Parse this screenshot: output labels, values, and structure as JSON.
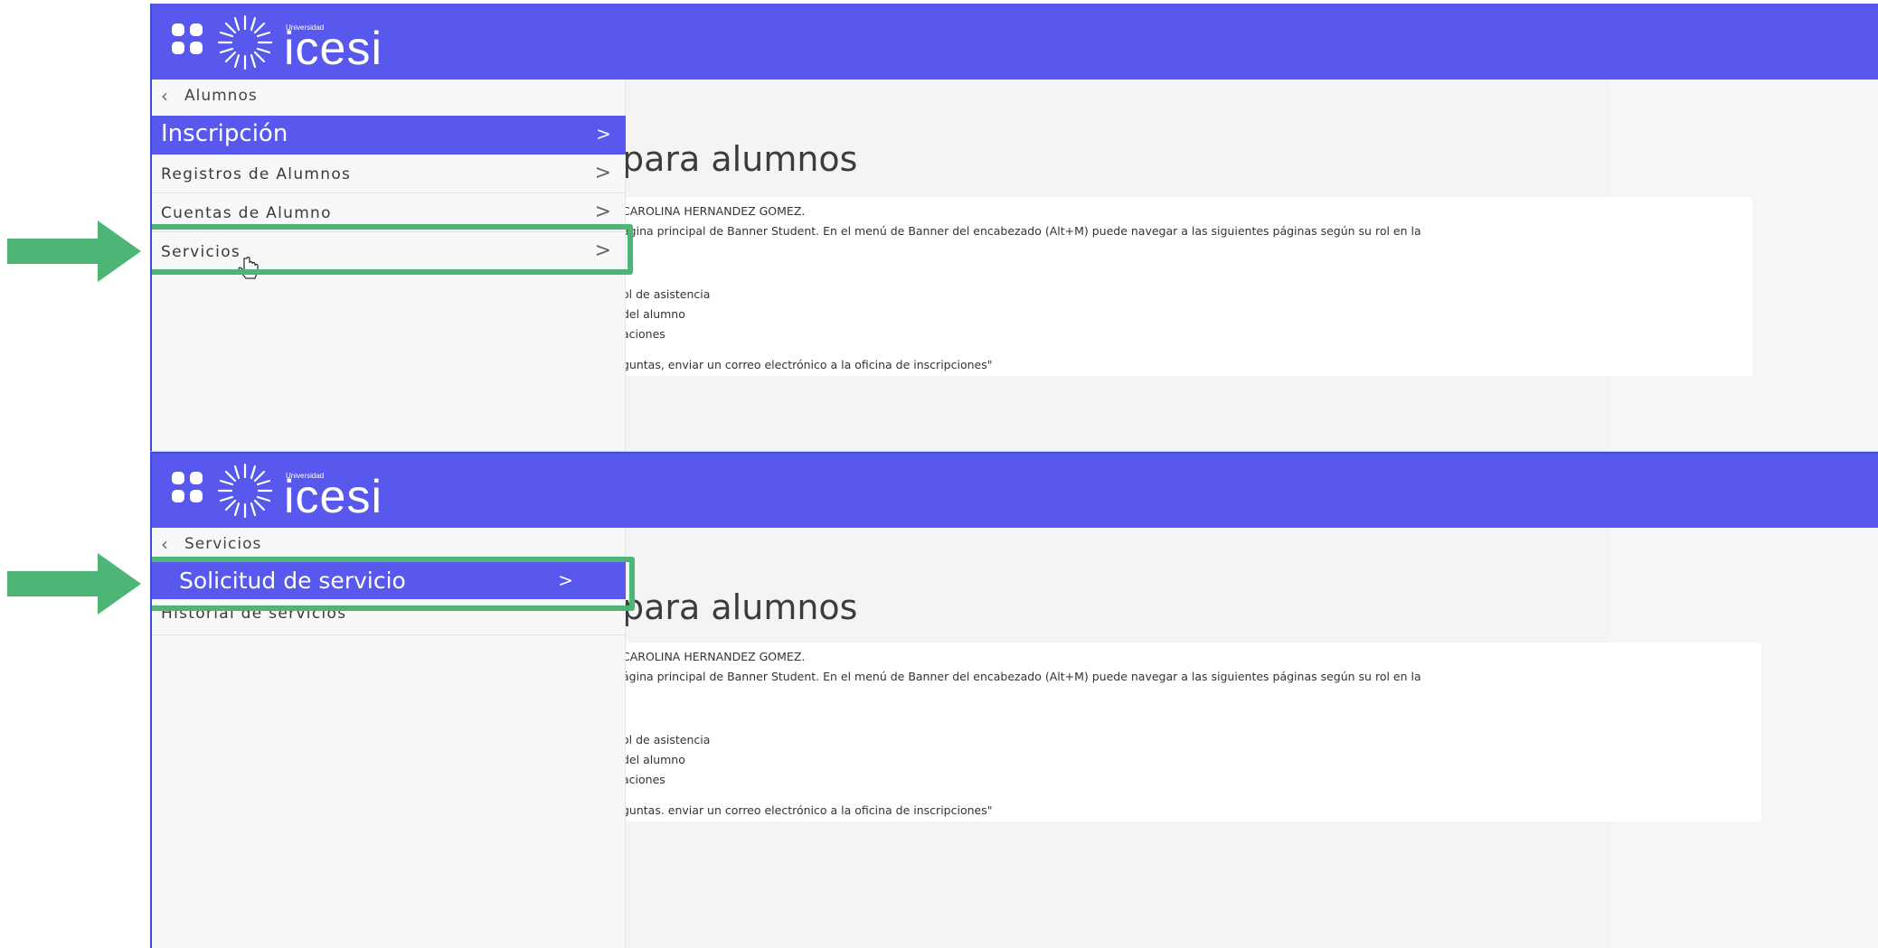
{
  "colors": {
    "header_bg": "#5858ee",
    "active_item_bg": "#5858ee",
    "highlight": "#4db575",
    "arrow": "#4db575"
  },
  "logo": {
    "small_text": "Universidad",
    "word": "icesi"
  },
  "panel1": {
    "back_label": "Alumnos",
    "menu": [
      {
        "label": "Inscripción",
        "arrow": ">",
        "active": true
      },
      {
        "label": "Registros de Alumnos",
        "arrow": ">",
        "active": false
      },
      {
        "label": "Cuentas de Alumno",
        "arrow": ">",
        "active": false
      },
      {
        "label": "Servicios",
        "arrow": ">",
        "active": false,
        "highlighted": true
      }
    ],
    "heading": "para alumnos",
    "card": {
      "greeting": "CAROLINA HERNANDEZ GOMEZ.",
      "intro": "ágina principal de Banner Student. En el menú de Banner del encabezado (Alt+M) puede navegar a las siguientes páginas según su rol en la",
      "items": [
        "ol de asistencia",
        "del alumno",
        "aciones"
      ],
      "contact": "guntas, enviar un correo electrónico a la oficina de inscripciones\""
    }
  },
  "panel2": {
    "back_label": "Servicios",
    "menu": [
      {
        "label": "Solicitud de servicio",
        "arrow": ">",
        "active": true,
        "highlighted": true
      },
      {
        "label": "Historial de servicios",
        "arrow": "",
        "active": false
      }
    ],
    "heading": "para alumnos",
    "card": {
      "greeting": "CAROLINA HERNANDEZ GOMEZ.",
      "intro": "ágina principal de Banner Student. En el menú de Banner del encabezado (Alt+M) puede navegar a las siguientes páginas según su rol en la",
      "items": [
        "ol de asistencia",
        "del alumno",
        "aciones"
      ],
      "contact": "guntas. enviar un correo electrónico a la oficina de inscripciones\""
    }
  }
}
